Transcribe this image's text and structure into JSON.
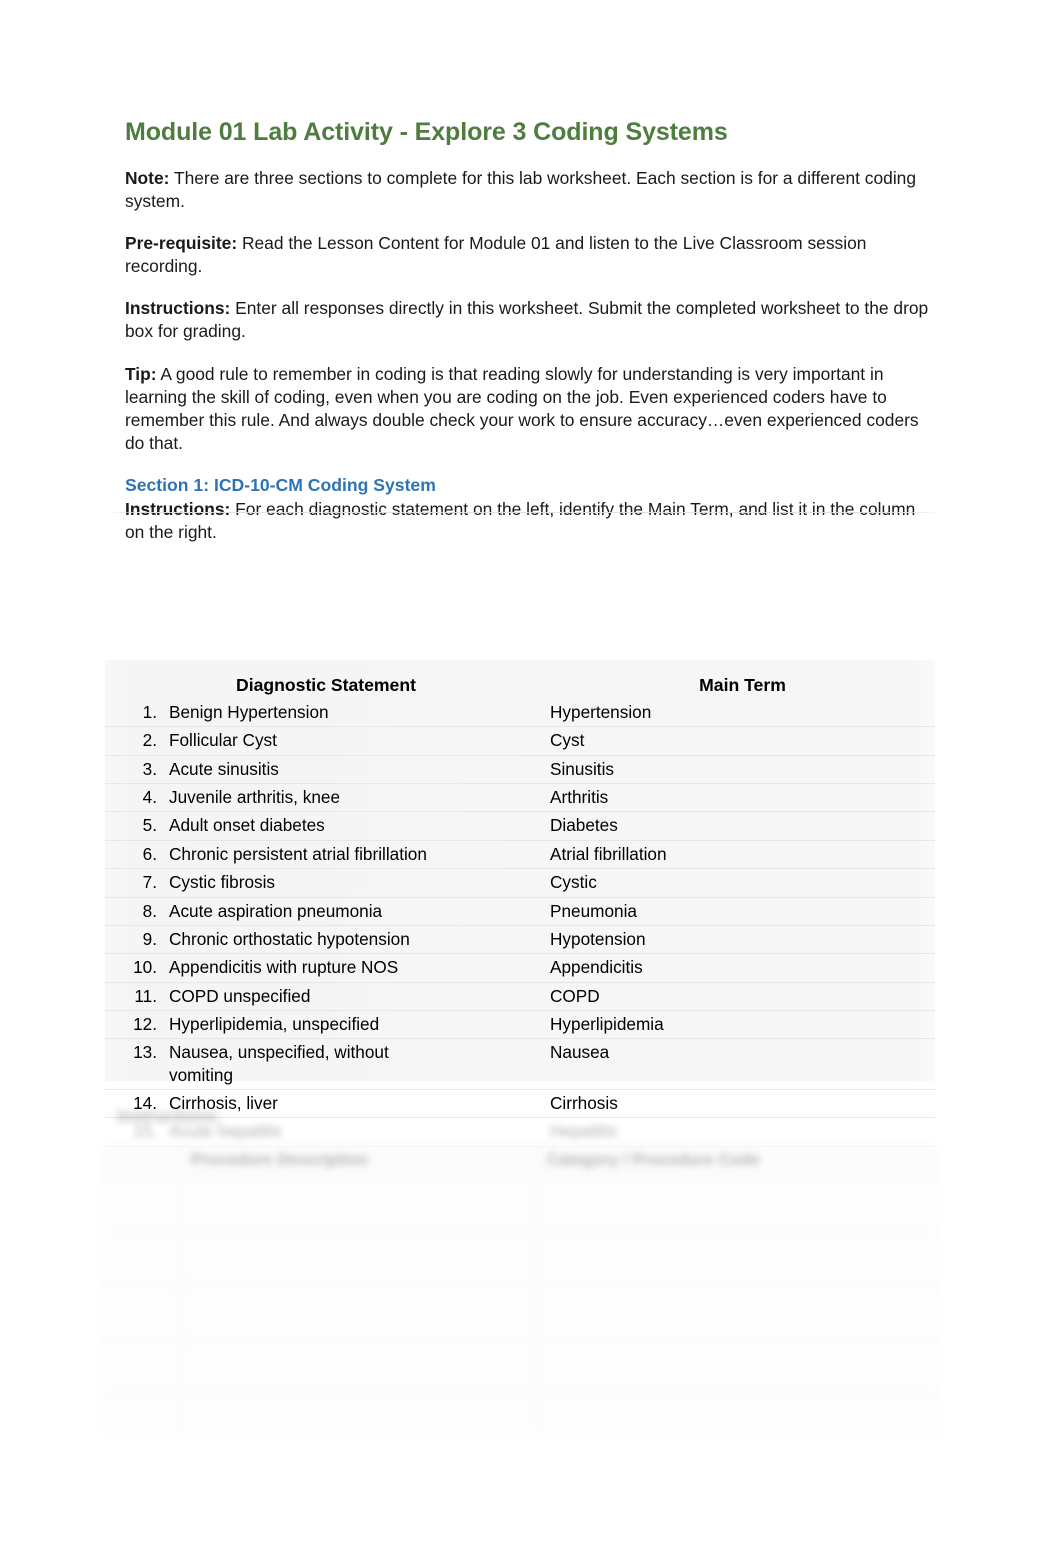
{
  "document": {
    "title": "Module 01 Lab Activity - Explore 3 Coding Systems",
    "title_color": "#4f7d3f",
    "section_heading_color": "#2e74b5"
  },
  "intro": {
    "note": {
      "label": "Note:",
      "text": " There are three sections to complete for this lab worksheet. Each section is for a different coding system."
    },
    "prerequisite": {
      "label": "Pre-requisite:",
      "text": " Read the Lesson Content for Module 01 and listen to the Live Classroom session recording."
    },
    "instructions": {
      "label": "Instructions:",
      "text": " Enter all responses directly in this worksheet. Submit the completed worksheet to the drop box for grading."
    },
    "tip": {
      "label": "Tip:",
      "text": " A good rule to remember in coding is that reading slowly for understanding is very important in learning the skill of coding, even when you are coding on the job. Even experienced coders have to remember this rule. And always double check your work to ensure accuracy…even experienced coders do that."
    }
  },
  "section1": {
    "heading": "Section 1: ICD-10-CM Coding System",
    "instructions_label": "Instructions:",
    "instructions_text": " For each diagnostic statement on the left, identify the Main Term, and list it in the column on the right.",
    "table": {
      "headers": [
        "Diagnostic Statement",
        "Main Term"
      ],
      "rows": [
        {
          "num": "1.",
          "statement": "Benign Hypertension",
          "main_term": "Hypertension"
        },
        {
          "num": "2.",
          "statement": "Follicular Cyst",
          "main_term": "Cyst"
        },
        {
          "num": "3.",
          "statement": "Acute sinusitis",
          "main_term": "Sinusitis"
        },
        {
          "num": "4.",
          "statement": "Juvenile arthritis, knee",
          "main_term": "Arthritis"
        },
        {
          "num": "5.",
          "statement": "Adult onset diabetes",
          "main_term": "Diabetes"
        },
        {
          "num": "6.",
          "statement": "Chronic persistent atrial fibrillation",
          "main_term": "Atrial fibrillation"
        },
        {
          "num": "7.",
          "statement": "Cystic fibrosis",
          "main_term": "Cystic"
        },
        {
          "num": "8.",
          "statement": "Acute aspiration pneumonia",
          "main_term": "Pneumonia"
        },
        {
          "num": "9.",
          "statement": "Chronic orthostatic hypotension",
          "main_term": "Hypotension"
        },
        {
          "num": "10.",
          "statement": "Appendicitis with rupture NOS",
          "main_term": "Appendicitis"
        },
        {
          "num": "11.",
          "statement": "COPD unspecified",
          "main_term": "COPD"
        },
        {
          "num": "12.",
          "statement": "Hyperlipidemia, unspecified",
          "main_term": "Hyperlipidemia"
        },
        {
          "num": "13.",
          "statement": "Nausea, unspecified, without vomiting",
          "main_term": "Nausea"
        },
        {
          "num": "14.",
          "statement": "Cirrhosis, liver",
          "main_term": "Cirrhosis"
        },
        {
          "num": "15.",
          "statement": "Acute hepatitis",
          "main_term": "Hepatitis"
        }
      ]
    }
  },
  "section2_obscured": {
    "instructions_label": "Instructions:",
    "instructions_text": "",
    "table": {
      "headers": [
        "",
        "Procedure Description",
        "Category / Procedure Code"
      ],
      "rows": [
        {
          "num": "",
          "description": "",
          "code": ""
        },
        {
          "num": "",
          "description": "",
          "code": ""
        },
        {
          "num": "",
          "description": "",
          "code": ""
        },
        {
          "num": "",
          "description": "",
          "code": ""
        },
        {
          "num": "",
          "description": "",
          "code": ""
        }
      ]
    }
  },
  "footer": {
    "page_label": ""
  }
}
